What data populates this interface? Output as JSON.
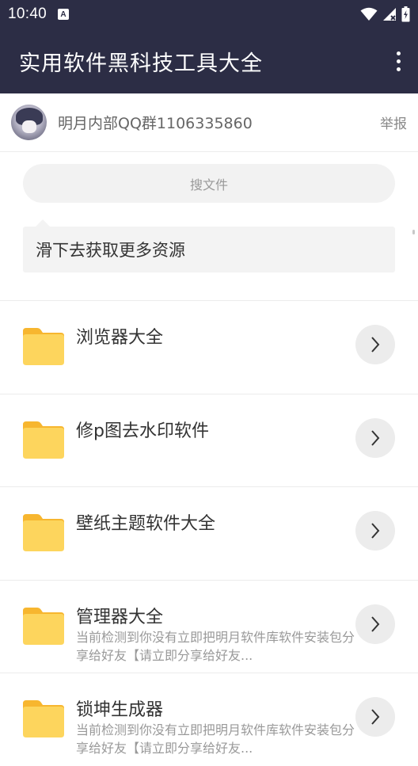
{
  "status_bar": {
    "time": "10:40",
    "notification_icon": "A"
  },
  "app_bar": {
    "title": "实用软件黑科技工具大全",
    "menu_icon": "more-vertical-icon"
  },
  "owner": {
    "group_name": "明月内部QQ群1106335860",
    "report_label": "举报"
  },
  "search": {
    "placeholder": "搜文件"
  },
  "hint": {
    "text": "滑下去获取更多资源"
  },
  "folders": [
    {
      "title": "浏览器大全",
      "desc": ""
    },
    {
      "title": "修p图去水印软件",
      "desc": ""
    },
    {
      "title": "壁纸主题软件大全",
      "desc": ""
    },
    {
      "title": "管理器大全",
      "desc": "当前检测到你没有立即把明月软件库软件安装包分享给好友【请立即分享给好友..."
    },
    {
      "title": "锁坤生成器",
      "desc": "当前检测到你没有立即把明月软件库软件安装包分享给好友【请立即分享给好友..."
    }
  ],
  "colors": {
    "app_bar": "#2c2d45",
    "folder": "#fdd55d",
    "folder_tab": "#f7b62f"
  }
}
